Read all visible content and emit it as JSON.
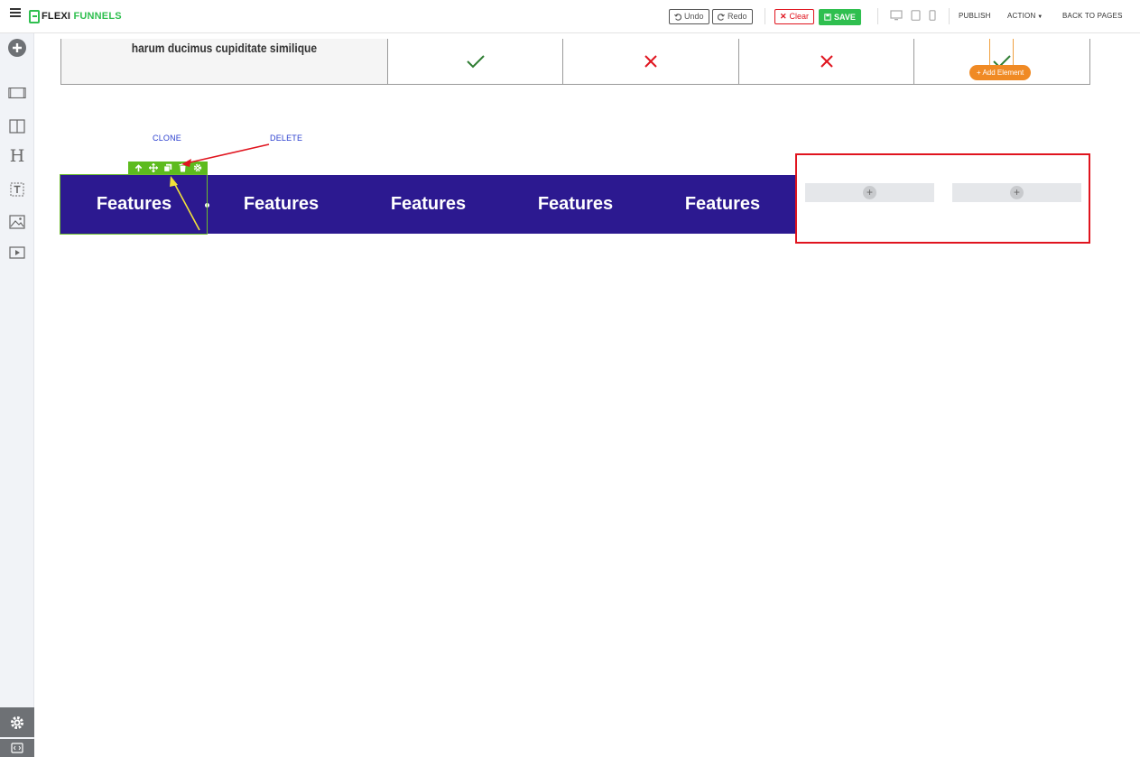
{
  "app": {
    "logo_part1": "FLEXI",
    "logo_part2": "FUNNELS",
    "brand_color": "#2fbf4f"
  },
  "header": {
    "undo_label": "Undo",
    "redo_label": "Redo",
    "clear_label": "Clear",
    "save_label": "SAVE",
    "publish_label": "PUBLISH",
    "action_label": "ACTION",
    "back_label": "BACK TO PAGES",
    "device_icons": [
      "desktop-icon",
      "tablet-icon",
      "mobile-icon"
    ]
  },
  "sidebar": {
    "items": [
      "add-icon",
      "section-icon",
      "columns-icon",
      "heading-icon",
      "text-icon",
      "image-icon",
      "video-icon"
    ],
    "bottom_items": [
      "settings-icon",
      "code-icon"
    ]
  },
  "comparison_row": {
    "label": "harum ducimus cupiditate similique",
    "cells": [
      {
        "icon": "check",
        "color": "#2e7d32"
      },
      {
        "icon": "cross",
        "color": "#e0141e"
      },
      {
        "icon": "cross",
        "color": "#e0141e"
      },
      {
        "icon": "check",
        "color": "#2e7d32"
      }
    ],
    "add_element_label": "+ Add Element"
  },
  "annotations": {
    "clone_label": "CLONE",
    "delete_label": "DELETE"
  },
  "features_bar": {
    "background": "#2c1990",
    "items": [
      "Features",
      "Features",
      "Features",
      "Features",
      "Features"
    ]
  },
  "element_toolbar": {
    "tools": [
      "arrow-up-icon",
      "move-icon",
      "clone-icon",
      "delete-icon",
      "settings-icon"
    ],
    "color": "#5dbb1e"
  },
  "empty_slots": {
    "plus": "+"
  }
}
